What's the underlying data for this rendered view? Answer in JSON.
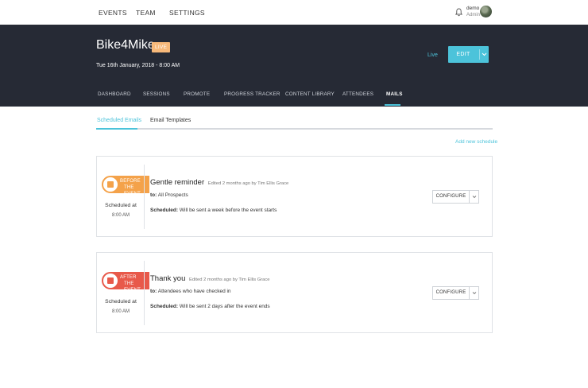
{
  "topnav": {
    "items": [
      "EVENTS",
      "TEAM",
      "SETTINGS"
    ],
    "user": {
      "name": "demo",
      "role": "Admin"
    }
  },
  "event": {
    "title": "Bike4Mike",
    "badge": "LIVE",
    "date": "Tue 16th January, 2018 - 8:00 AM",
    "status": "Live",
    "edit_label": "EDIT"
  },
  "tabs": [
    "DASHBOARD",
    "SESSIONS",
    "PROMOTE",
    "PROGRESS TRACKER",
    "CONTENT LIBRARY",
    "ATTENDEES",
    "MAILS"
  ],
  "active_tab": "MAILS",
  "subtabs": [
    "Scheduled Emails",
    "Email Templates"
  ],
  "active_subtab": "Scheduled Emails",
  "add_schedule_label": "Add new schedule",
  "emails": [
    {
      "tag_line1": "BEFORE",
      "tag_line2": "THE EVENT",
      "tag_color": "#f4a24a",
      "scheduled_label": "Scheduled at",
      "scheduled_time": "8:00 AM",
      "title": "Gentle reminder",
      "meta": "Edited 2 months ago by Tim Ellis Grace",
      "to_label": "to:",
      "to_value": "All Prospects",
      "schedule_label": "Scheduled:",
      "schedule_value": "Will be sent a week before the event starts",
      "configure_label": "CONFIGURE"
    },
    {
      "tag_line1": "AFTER",
      "tag_line2": "THE EVENT",
      "tag_color": "#e8594a",
      "scheduled_label": "Scheduled at",
      "scheduled_time": "8:00 AM",
      "title": "Thank you",
      "meta": "Edited 2 months ago by Tim Ellis Grace",
      "to_label": "to:",
      "to_value": "Attendees who have checked in",
      "schedule_label": "Scheduled:",
      "schedule_value": "Will be sent 2 days after the event ends",
      "configure_label": "CONFIGURE"
    }
  ],
  "colors": {
    "accent": "#4cc3da",
    "header_bg": "#262a35",
    "live_badge": "#f7b97a"
  }
}
